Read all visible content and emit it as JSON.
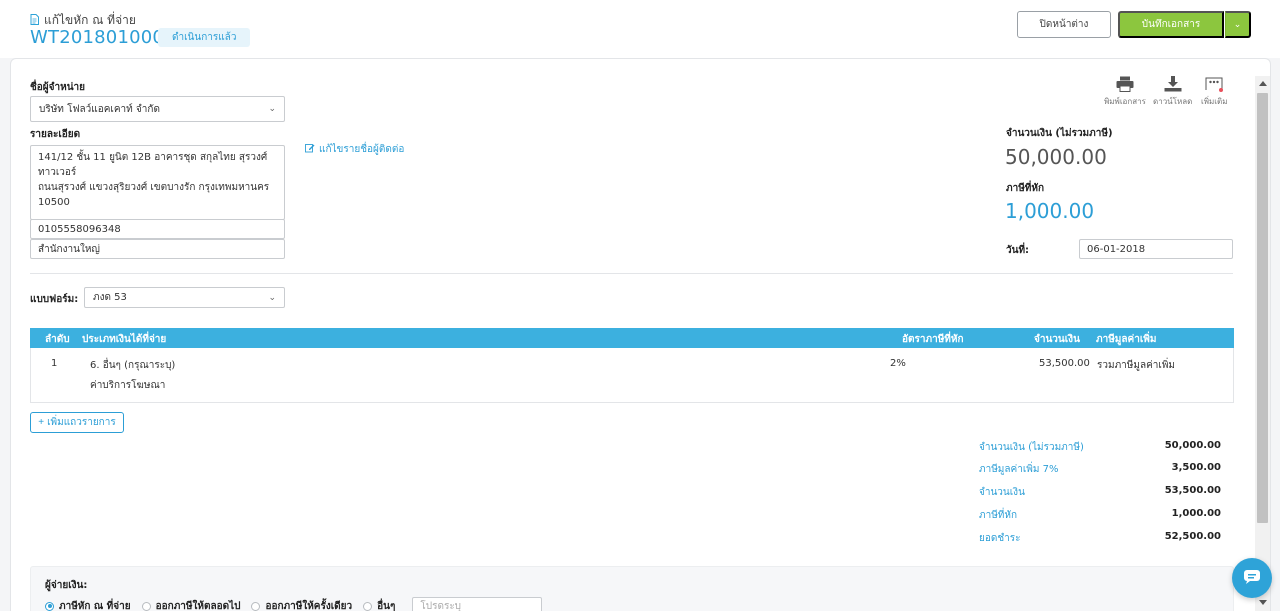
{
  "header": {
    "caption": "แก้ไขหัก ณ ที่จ่าย",
    "doc_number": "WT2018010001",
    "status": "ดำเนินการแล้ว",
    "close_label": "ปิดหน้าต่าง",
    "save_label": "บันทึกเอกสาร"
  },
  "vendor": {
    "label": "ชื่อผู้จำหน่าย",
    "selected": "บริษัท โฟลว์แอคเคาท์ จำกัด",
    "details_label": "รายละเอียด",
    "address": "141/12 ชั้น 11 ยูนิต 12B อาคารชุด สกุลไทย สุรวงศ์ ทาวเวอร์\nถนนสุรวงศ์ แขวงสุริยวงศ์ เขตบางรัก กรุงเทพมหานคร\n10500",
    "tax_id": "0105558096348",
    "branch": "สำนักงานใหญ่",
    "edit_contact": "แก้ไขรายชื่อผู้ติดต่อ"
  },
  "actions": {
    "print": "พิมพ์เอกสาร",
    "download": "ดาวน์โหลด",
    "more": "เพิ่มเติม"
  },
  "amounts": {
    "subtotal_label": "จำนวนเงิน (ไม่รวมภาษี)",
    "subtotal": "50,000.00",
    "wht_label": "ภาษีที่หัก",
    "wht": "1,000.00",
    "date_label": "วันที่:",
    "date": "06-01-2018"
  },
  "form": {
    "label": "แบบฟอร์ม:",
    "selected": "ภงด 53"
  },
  "table": {
    "headers": [
      "ลำดับ",
      "ประเภทเงินได้ที่จ่าย",
      "อัตราภาษีที่หัก",
      "จำนวนเงิน",
      "ภาษีมูลค่าเพิ่ม"
    ],
    "rows": [
      {
        "no": "1",
        "type": "6. อื่นๆ (กรุณาระบุ)",
        "desc": "ค่าบริการโฆษณา",
        "rate": "2%",
        "amount": "53,500.00",
        "vat": "รวมภาษีมูลค่าเพิ่ม"
      }
    ],
    "add_row": "เพิ่มแถวรายการ"
  },
  "summary": [
    {
      "label": "จำนวนเงิน (ไม่รวมภาษี)",
      "value": "50,000.00"
    },
    {
      "label": "ภาษีมูลค่าเพิ่ม 7%",
      "value": "3,500.00"
    },
    {
      "label": "จำนวนเงิน",
      "value": "53,500.00"
    },
    {
      "label": "ภาษีที่หัก",
      "value": "1,000.00"
    },
    {
      "label": "ยอดชำระ",
      "value": "52,500.00"
    }
  ],
  "payer": {
    "label": "ผู้จ่ายเงิน:",
    "options": [
      "ภาษีหัก ณ ที่จ่าย",
      "ออกภาษีให้ตลอดไป",
      "ออกภาษีให้ครั้งเดียว",
      "อื่นๆ"
    ],
    "selected_index": 0,
    "other_placeholder": "โปรดระบุ"
  },
  "colors": {
    "accent": "#2c9ed6",
    "table_header": "#3cb0df",
    "save_button": "#8cc63e"
  }
}
